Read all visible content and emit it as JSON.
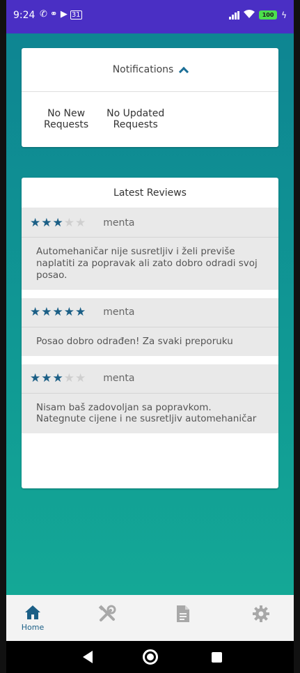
{
  "status_bar": {
    "time": "9:24",
    "left_icons": [
      "wifi-calling-icon",
      "link-icon",
      "youtube-icon",
      "calendar-icon"
    ],
    "calendar_day": "31",
    "battery": "100"
  },
  "notifications": {
    "title": "Notifications",
    "items": [
      {
        "line1": "No New",
        "line2": "Requests"
      },
      {
        "line1": "No Updated",
        "line2": "Requests"
      }
    ]
  },
  "reviews": {
    "title": "Latest Reviews",
    "items": [
      {
        "rating": 3,
        "max": 5,
        "author": "menta",
        "text": "Automehaničar nije susretljiv i želi previše naplatiti za popravak ali zato dobro odradi svoj posao."
      },
      {
        "rating": 5,
        "max": 5,
        "author": "menta",
        "text": "Posao dobro odrađen! Za svaki preporuku"
      },
      {
        "rating": 3,
        "max": 5,
        "author": "menta",
        "text": "Nisam baš zadovoljan sa popravkom. Nategnute cijene i ne susretljiv automehaničar"
      }
    ]
  },
  "bottom_nav": {
    "items": [
      {
        "icon": "home-icon",
        "label": "Home",
        "active": true
      },
      {
        "icon": "tools-icon",
        "label": "",
        "active": false
      },
      {
        "icon": "document-icon",
        "label": "",
        "active": false
      },
      {
        "icon": "settings-icon",
        "label": "",
        "active": false
      }
    ]
  },
  "colors": {
    "status_bar": "#4a2fc4",
    "background_top": "#0e8592",
    "background_bottom": "#14a896",
    "accent": "#1b5f86",
    "inactive_icon": "#a8a8a8"
  }
}
